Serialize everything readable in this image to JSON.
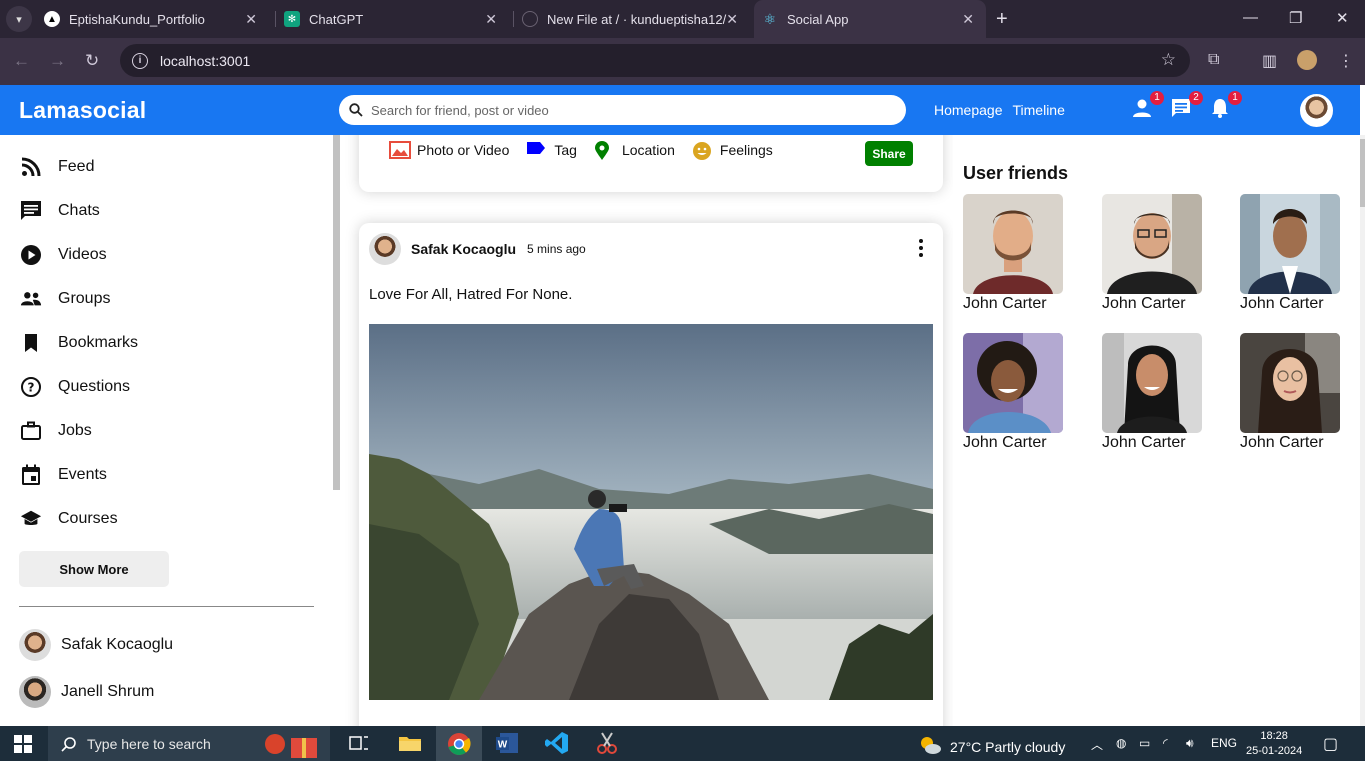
{
  "browser": {
    "tabs": [
      {
        "title": "EptishaKundu_Portfolio"
      },
      {
        "title": "ChatGPT"
      },
      {
        "title": "New File at / · kundueptisha12/"
      },
      {
        "title": "Social App"
      }
    ],
    "url": "localhost:3001"
  },
  "app": {
    "logo": "Lamasocial",
    "search_placeholder": "Search for friend, post or video",
    "links": [
      "Homepage",
      "Timeline"
    ],
    "badges": {
      "friends": "1",
      "messages": "2",
      "notifications": "1"
    }
  },
  "sidebar": {
    "items": [
      {
        "label": "Feed",
        "icon": "rss-feed-icon"
      },
      {
        "label": "Chats",
        "icon": "chat-icon"
      },
      {
        "label": "Videos",
        "icon": "play-circle-icon"
      },
      {
        "label": "Groups",
        "icon": "group-icon"
      },
      {
        "label": "Bookmarks",
        "icon": "bookmark-icon"
      },
      {
        "label": "Questions",
        "icon": "help-circle-icon"
      },
      {
        "label": "Jobs",
        "icon": "briefcase-icon"
      },
      {
        "label": "Events",
        "icon": "calendar-icon"
      },
      {
        "label": "Courses",
        "icon": "school-icon"
      }
    ],
    "show_more": "Show More",
    "friends": [
      "Safak Kocaoglu",
      "Janell Shrum"
    ]
  },
  "share": {
    "options": [
      {
        "label": "Photo or Video",
        "icon": "photo-icon",
        "color": "#e74c3c"
      },
      {
        "label": "Tag",
        "icon": "label-icon",
        "color": "#0000ff"
      },
      {
        "label": "Location",
        "icon": "location-icon",
        "color": "#008000"
      },
      {
        "label": "Feelings",
        "icon": "emoji-icon",
        "color": "#daa520"
      }
    ],
    "button": "Share"
  },
  "post": {
    "username": "Safak Kocaoglu",
    "time": "5 mins ago",
    "text": "Love For All, Hatred For None."
  },
  "rightbar": {
    "title": "User friends",
    "friends": [
      "John Carter",
      "John Carter",
      "John Carter",
      "John Carter",
      "John Carter",
      "John Carter"
    ]
  },
  "taskbar": {
    "search_placeholder": "Type here to search",
    "weather": "27°C  Partly cloudy",
    "lang": "ENG",
    "time": "18:28",
    "date": "25-01-2024"
  },
  "colors": {
    "brand": "#1877f2",
    "share": "#008000",
    "badge": "#e41e3f"
  }
}
